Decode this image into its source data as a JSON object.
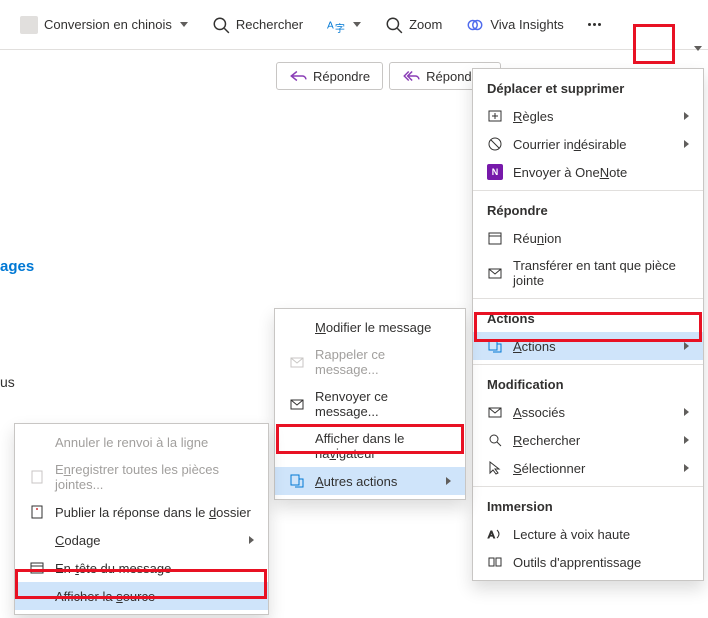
{
  "ribbon": {
    "chinese": "Conversion en chinois",
    "search": "Rechercher",
    "zoom": "Zoom",
    "viva": "Viva Insights"
  },
  "reply": {
    "reply": "Répondre",
    "replyall": "Répondre à"
  },
  "body": {
    "ages": "ages",
    "us": "us"
  },
  "m3": {
    "hdr1": "Déplacer et supprimer",
    "rules": "Règles",
    "junk": "Courrier indésirable",
    "onenote": "Envoyer à OneNote",
    "hdr2": "Répondre",
    "meeting": "Réunion",
    "fwdatt": "Transférer en tant que pièce jointe",
    "hdr3": "Actions",
    "actions": "Actions",
    "hdr4": "Modification",
    "assoc": "Associés",
    "search": "Rechercher",
    "select": "Sélectionner",
    "hdr5": "Immersion",
    "readaloud": "Lecture à voix haute",
    "learning": "Outils d'apprentissage"
  },
  "m2": {
    "modify": "Modifier le message",
    "recall": "Rappeler ce message...",
    "resend": "Renvoyer ce message...",
    "browser": "Afficher dans le navigateur",
    "other": "Autres actions"
  },
  "m1": {
    "unwrap": "Annuler le renvoi à la ligne",
    "saveatt": "Enregistrer toutes les pièces jointes...",
    "postfolder": "Publier la réponse dans le dossier",
    "encoding": "Codage",
    "header": "En-tête du message",
    "source": "Afficher la source"
  }
}
